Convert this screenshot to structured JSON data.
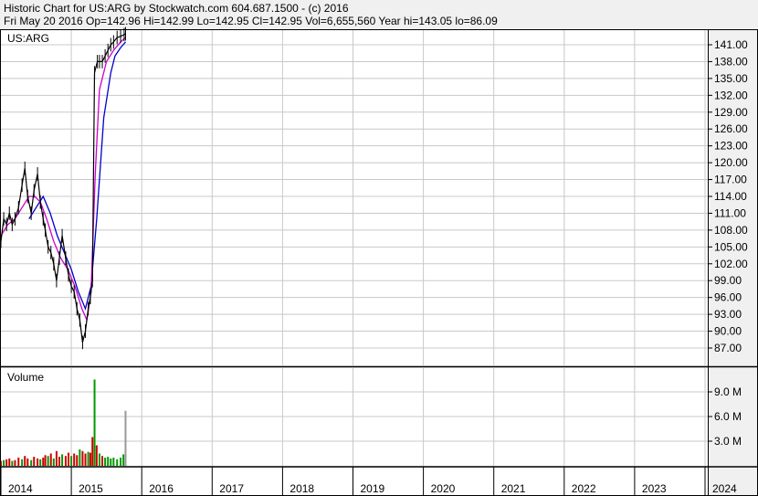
{
  "header": {
    "line1": "Historic Chart for US:ARG by Stockwatch.com 604.687.1500 - (c) 2016",
    "line2": "Fri May 20 2016   Op=142.96   Hi=142.99   Lo=142.95   Cl=142.95   Vol=6,655,560   Year hi=143.05   lo=86.09"
  },
  "chart_data": {
    "type": "line",
    "symbol_label": "US:ARG",
    "volume_label": "Volume",
    "price_ticks": [
      "141.00",
      "138.00",
      "135.00",
      "132.00",
      "129.00",
      "126.00",
      "123.00",
      "120.00",
      "117.00",
      "114.00",
      "111.00",
      "108.00",
      "105.00",
      "102.00",
      "99.00",
      "96.00",
      "93.00",
      "90.00",
      "87.00"
    ],
    "volume_ticks": [
      "9.0 M",
      "6.0 M",
      "3.0 M"
    ],
    "x_ticks": [
      "2014",
      "2015",
      "2016",
      "2017",
      "2018",
      "2019",
      "2020",
      "2021",
      "2022",
      "2023",
      "2024"
    ],
    "colors": {
      "price": "#000000",
      "ma_short": "#cc00cc",
      "ma_long": "#0000cc",
      "vol_up": "#009900",
      "vol_down": "#cc0000",
      "vol_last": "#999999",
      "grid": "#c8c8c8",
      "plot_bg": "#ffffff"
    },
    "price_series": [
      [
        2014.0,
        106
      ],
      [
        2014.04,
        110
      ],
      [
        2014.08,
        109
      ],
      [
        2014.12,
        111
      ],
      [
        2014.16,
        109
      ],
      [
        2014.2,
        110
      ],
      [
        2014.25,
        112
      ],
      [
        2014.3,
        116
      ],
      [
        2014.34,
        119
      ],
      [
        2014.38,
        114
      ],
      [
        2014.43,
        111
      ],
      [
        2014.47,
        115
      ],
      [
        2014.52,
        118
      ],
      [
        2014.56,
        113
      ],
      [
        2014.6,
        110
      ],
      [
        2014.63,
        108
      ],
      [
        2014.67,
        105
      ],
      [
        2014.71,
        104
      ],
      [
        2014.75,
        102
      ],
      [
        2014.79,
        99
      ],
      [
        2014.83,
        103
      ],
      [
        2014.87,
        107
      ],
      [
        2014.92,
        103
      ],
      [
        2014.96,
        100
      ],
      [
        2015.0,
        98
      ],
      [
        2015.04,
        97
      ],
      [
        2015.08,
        94
      ],
      [
        2015.12,
        92
      ],
      [
        2015.16,
        88
      ],
      [
        2015.2,
        90
      ],
      [
        2015.24,
        94
      ],
      [
        2015.27,
        96
      ],
      [
        2015.3,
        99
      ],
      [
        2015.33,
        136
      ],
      [
        2015.37,
        138
      ],
      [
        2015.4,
        138
      ],
      [
        2015.44,
        138
      ],
      [
        2015.48,
        139
      ],
      [
        2015.52,
        140
      ],
      [
        2015.56,
        141
      ],
      [
        2015.6,
        141.5
      ],
      [
        2015.65,
        142.3
      ],
      [
        2015.7,
        142.5
      ],
      [
        2015.75,
        142.8
      ],
      [
        2015.77,
        142.95
      ]
    ],
    "ma_short_series": [
      [
        2014.0,
        107
      ],
      [
        2014.1,
        109
      ],
      [
        2014.2,
        110
      ],
      [
        2014.3,
        112
      ],
      [
        2014.4,
        114
      ],
      [
        2014.48,
        114
      ],
      [
        2014.56,
        113
      ],
      [
        2014.65,
        110
      ],
      [
        2014.75,
        106
      ],
      [
        2014.85,
        103
      ],
      [
        2014.95,
        101
      ],
      [
        2015.05,
        98
      ],
      [
        2015.15,
        94
      ],
      [
        2015.22,
        92
      ],
      [
        2015.28,
        97
      ],
      [
        2015.34,
        118
      ],
      [
        2015.4,
        133
      ],
      [
        2015.5,
        138
      ],
      [
        2015.6,
        140
      ],
      [
        2015.7,
        141.5
      ],
      [
        2015.77,
        142.3
      ]
    ],
    "ma_long_series": [
      [
        2014.4,
        110
      ],
      [
        2014.5,
        112
      ],
      [
        2014.6,
        114
      ],
      [
        2014.7,
        111
      ],
      [
        2014.8,
        107
      ],
      [
        2014.9,
        104
      ],
      [
        2015.0,
        101
      ],
      [
        2015.1,
        97
      ],
      [
        2015.2,
        94
      ],
      [
        2015.28,
        98
      ],
      [
        2015.36,
        110
      ],
      [
        2015.46,
        128
      ],
      [
        2015.56,
        136
      ],
      [
        2015.62,
        139
      ],
      [
        2015.7,
        140.5
      ],
      [
        2015.77,
        141.5
      ]
    ],
    "volume_series": [
      [
        2014.0,
        0.6,
        "down"
      ],
      [
        2014.04,
        0.7,
        "up"
      ],
      [
        2014.08,
        0.8,
        "down"
      ],
      [
        2014.12,
        0.9,
        "down"
      ],
      [
        2014.16,
        0.6,
        "up"
      ],
      [
        2014.2,
        0.7,
        "down"
      ],
      [
        2014.25,
        1.0,
        "down"
      ],
      [
        2014.3,
        0.8,
        "up"
      ],
      [
        2014.34,
        1.2,
        "down"
      ],
      [
        2014.38,
        0.9,
        "down"
      ],
      [
        2014.43,
        0.7,
        "up"
      ],
      [
        2014.47,
        1.1,
        "down"
      ],
      [
        2014.52,
        0.9,
        "down"
      ],
      [
        2014.56,
        0.8,
        "up"
      ],
      [
        2014.6,
        1.0,
        "down"
      ],
      [
        2014.63,
        1.3,
        "down"
      ],
      [
        2014.67,
        1.2,
        "up"
      ],
      [
        2014.71,
        1.5,
        "down"
      ],
      [
        2014.75,
        0.9,
        "up"
      ],
      [
        2014.79,
        1.8,
        "down"
      ],
      [
        2014.83,
        1.1,
        "down"
      ],
      [
        2014.87,
        1.4,
        "up"
      ],
      [
        2014.92,
        1.2,
        "down"
      ],
      [
        2014.96,
        1.6,
        "down"
      ],
      [
        2015.0,
        1.2,
        "up"
      ],
      [
        2015.04,
        1.5,
        "down"
      ],
      [
        2015.08,
        1.3,
        "down"
      ],
      [
        2015.12,
        2.0,
        "up"
      ],
      [
        2015.16,
        1.8,
        "down"
      ],
      [
        2015.2,
        1.5,
        "down"
      ],
      [
        2015.24,
        1.7,
        "up"
      ],
      [
        2015.27,
        1.6,
        "down"
      ],
      [
        2015.3,
        3.5,
        "down"
      ],
      [
        2015.33,
        10.5,
        "up"
      ],
      [
        2015.36,
        2.5,
        "down"
      ],
      [
        2015.4,
        1.5,
        "up"
      ],
      [
        2015.44,
        1.2,
        "down"
      ],
      [
        2015.48,
        1.0,
        "up"
      ],
      [
        2015.52,
        1.1,
        "up"
      ],
      [
        2015.56,
        0.9,
        "up"
      ],
      [
        2015.6,
        1.0,
        "up"
      ],
      [
        2015.65,
        0.8,
        "up"
      ],
      [
        2015.7,
        1.0,
        "up"
      ],
      [
        2015.74,
        1.4,
        "up"
      ],
      [
        2015.77,
        6.7,
        "last"
      ]
    ],
    "price_range": [
      86,
      143
    ],
    "volume_max_m": 11.5
  }
}
